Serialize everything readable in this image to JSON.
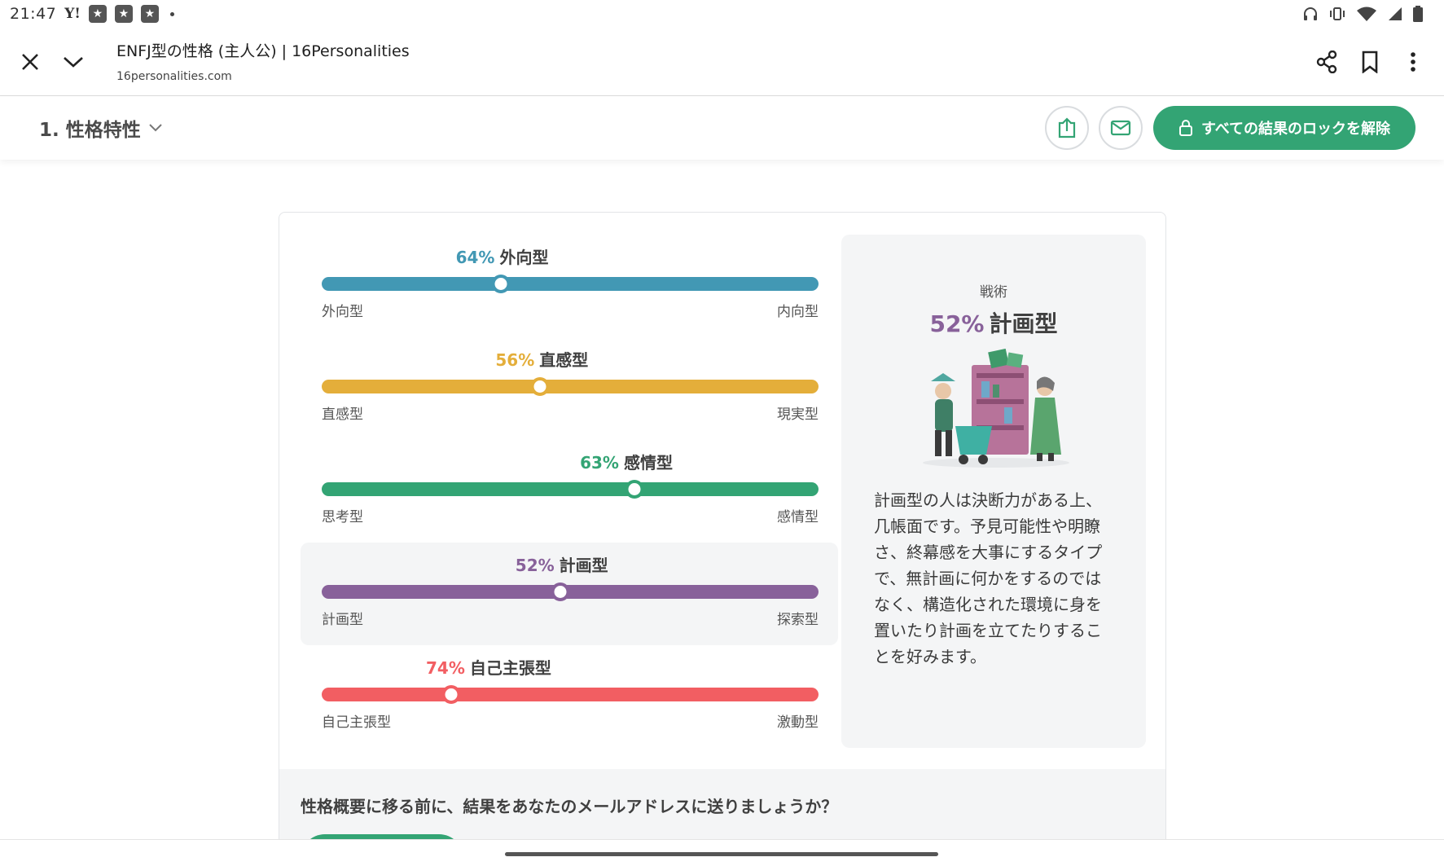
{
  "status_bar": {
    "time": "21:47",
    "yahoo_label": "Y!",
    "notification_icons": [
      "app-notification-icon",
      "app-notification-icon",
      "app-notification-icon"
    ],
    "right_icons": [
      "headset-icon",
      "vibrate-icon",
      "wifi-icon",
      "signal-icon",
      "battery-icon"
    ]
  },
  "browser": {
    "title": "ENFJ型の性格 (主人公) | 16Personalities",
    "url": "16personalities.com",
    "icons": [
      "close-icon",
      "chevron-down-icon",
      "share-icon",
      "bookmark-icon",
      "more-vert-icon"
    ]
  },
  "header": {
    "section_label": "1. 性格特性",
    "unlock_label": "すべての結果のロックを解除",
    "icons": [
      "export-icon",
      "mail-icon",
      "lock-icon"
    ]
  },
  "traits": [
    {
      "percent": 64,
      "percent_label": "64%",
      "name": "外向型",
      "left_label": "外向型",
      "right_label": "内向型",
      "color": "#4298b4",
      "position": 0.36
    },
    {
      "percent": 56,
      "percent_label": "56%",
      "name": "直感型",
      "left_label": "直感型",
      "right_label": "現実型",
      "color": "#e4ae3a",
      "position": 0.44
    },
    {
      "percent": 63,
      "percent_label": "63%",
      "name": "感情型",
      "left_label": "思考型",
      "right_label": "感情型",
      "color": "#33a474",
      "position": 0.63
    },
    {
      "percent": 52,
      "percent_label": "52%",
      "name": "計画型",
      "left_label": "計画型",
      "right_label": "探索型",
      "color": "#88619a",
      "position": 0.48
    },
    {
      "percent": 74,
      "percent_label": "74%",
      "name": "自己主張型",
      "left_label": "自己主張型",
      "right_label": "激動型",
      "color": "#f25e62",
      "position": 0.26
    }
  ],
  "side_panel": {
    "category": "戦術",
    "percent_label": "52%",
    "trait_name": "計画型",
    "description": "計画型の人は決断力がある上、几帳面です。予見可能性や明瞭さ、終幕感を大事にするタイプで、無計画に何かをするのではなく、構造化された環境に身を置いたり計画を立てたりすることを好みます。"
  },
  "email_prompt": {
    "text": "性格概要に移る前に、結果をあなたのメールアドレスに送りましょうか？"
  }
}
